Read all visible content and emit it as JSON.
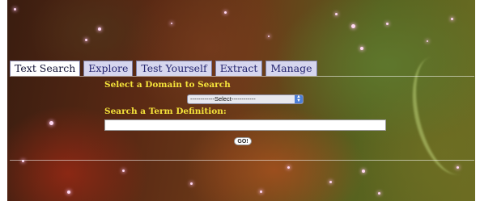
{
  "tabs": [
    {
      "label": "Text Search",
      "active": true
    },
    {
      "label": "Explore",
      "active": false
    },
    {
      "label": "Test Yourself",
      "active": false
    },
    {
      "label": "Extract",
      "active": false
    },
    {
      "label": "Manage",
      "active": false
    }
  ],
  "search": {
    "domain_label": "Select a Domain to Search",
    "domain_select_value": "------------Select------------",
    "term_label": "Search a Term Definition:",
    "term_input_value": "",
    "go_label": "GO!"
  },
  "colors": {
    "label_text": "#f4e23a",
    "tab_background": "#d6d6ee",
    "tab_active_background": "#ffffff",
    "tab_text": "#24246e"
  },
  "icons": {
    "select_arrow": "up-down-arrows-icon"
  }
}
